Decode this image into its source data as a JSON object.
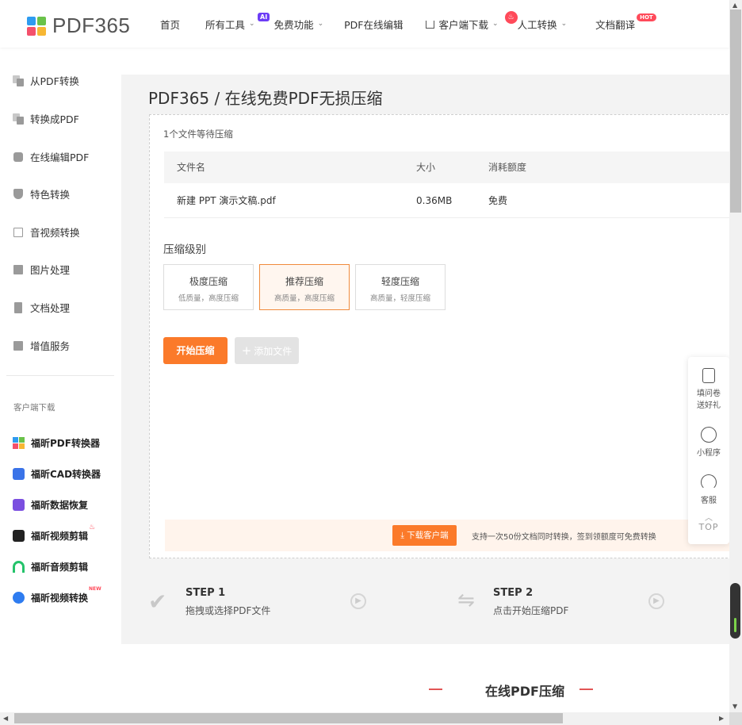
{
  "header": {
    "logo_text": "PDF365",
    "nav": {
      "home": "首页",
      "all_tools": "所有工具",
      "ai_badge": "AI",
      "free": "免费功能",
      "edit": "PDF在线编辑",
      "client_download": "客户端下载",
      "manual": "人工转换",
      "translate": "文档翻译",
      "hot_badge": "HOT"
    }
  },
  "sidebar": {
    "items": [
      {
        "label": "从PDF转换"
      },
      {
        "label": "转换成PDF"
      },
      {
        "label": "在线编辑PDF"
      },
      {
        "label": "特色转换"
      },
      {
        "label": "音视频转换"
      },
      {
        "label": "图片处理"
      },
      {
        "label": "文档处理"
      },
      {
        "label": "增值服务"
      }
    ],
    "section_title": "客户端下载",
    "downloads": [
      {
        "label": "福昕PDF转换器",
        "icon": "windows-icon"
      },
      {
        "label": "福昕CAD转换器",
        "icon": "cad-icon"
      },
      {
        "label": "福昕数据恢复",
        "icon": "recovery-icon"
      },
      {
        "label": "福昕视频剪辑",
        "icon": "video-edit-icon"
      },
      {
        "label": "福昕音频剪辑",
        "icon": "audio-edit-icon"
      },
      {
        "label": "福昕视频转换",
        "icon": "video-convert-icon",
        "badge": "NEW"
      }
    ]
  },
  "main": {
    "title": "PDF365 / 在线免费PDF无损压缩",
    "wait_text": "1个文件等待压缩",
    "table": {
      "headers": [
        "文件名",
        "大小",
        "消耗额度"
      ],
      "rows": [
        {
          "name": "新建 PPT 演示文稿.pdf",
          "size": "0.36MB",
          "cost": "免费"
        }
      ]
    },
    "level_label": "压缩级别",
    "levels": [
      {
        "title": "极度压缩",
        "desc": "低质量，高度压缩"
      },
      {
        "title": "推荐压缩",
        "desc": "高质量，高度压缩",
        "selected": true
      },
      {
        "title": "轻度压缩",
        "desc": "高质量，轻度压缩"
      }
    ],
    "start_button": "开始压缩",
    "add_button": "添加文件",
    "promo": {
      "button": "下载客户端",
      "text": "支持一次50份文档同时转换，签到领额度可免费转换"
    },
    "steps": [
      {
        "title": "STEP 1",
        "desc": "拖拽或选择PDF文件"
      },
      {
        "title": "STEP 2",
        "desc": "点击开始压缩PDF"
      }
    ],
    "bottom_title": "在线PDF压缩"
  },
  "float_panel": {
    "survey": "填问卷\n送好礼",
    "survey_l1": "填问卷",
    "survey_l2": "送好礼",
    "mini_program": "小程序",
    "service": "客服",
    "top": "TOP"
  },
  "colors": {
    "accent": "#fb7a2a",
    "ai_badge": "#6d3df6",
    "hot_badge": "#ff4a5a"
  }
}
